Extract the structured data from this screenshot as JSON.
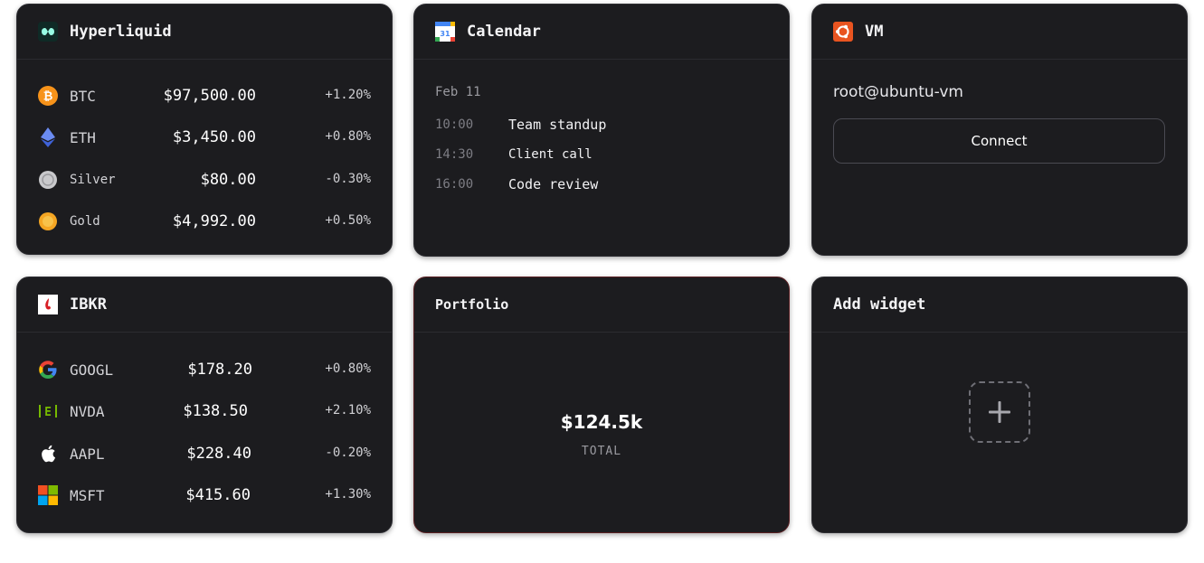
{
  "hyperliquid": {
    "title": "Hyperliquid",
    "icon": "hyperliquid-logo",
    "rows": [
      {
        "icon": "bitcoin-icon",
        "symbol": "BTC",
        "price": "$97,500.00",
        "change": "+1.20%"
      },
      {
        "icon": "ethereum-icon",
        "symbol": "ETH",
        "price": "$3,450.00",
        "change": "+0.80%"
      },
      {
        "icon": "silver-coin-icon",
        "symbol": "Silver",
        "price": "$80.00",
        "change": "-0.30%"
      },
      {
        "icon": "gold-coin-icon",
        "symbol": "Gold",
        "price": "$4,992.00",
        "change": "+0.50%"
      }
    ]
  },
  "calendar": {
    "title": "Calendar",
    "icon": "google-calendar-icon",
    "icon_day": "31",
    "date": "Feb 11",
    "events": [
      {
        "time": "10:00",
        "name": "Team standup"
      },
      {
        "time": "14:30",
        "name": "Client call"
      },
      {
        "time": "16:00",
        "name": "Code review"
      }
    ]
  },
  "vm": {
    "title": "VM",
    "icon": "ubuntu-icon",
    "host": "root@ubuntu-vm",
    "connect_label": "Connect"
  },
  "ibkr": {
    "title": "IBKR",
    "icon": "ibkr-logo",
    "rows": [
      {
        "icon": "google-icon",
        "symbol": "GOOGL",
        "price": "$178.20",
        "change": "+0.80%"
      },
      {
        "icon": "nvidia-icon",
        "symbol": "NVDA",
        "price": "$138.50",
        "change": "+2.10%"
      },
      {
        "icon": "apple-icon",
        "symbol": "AAPL",
        "price": "$228.40",
        "change": "-0.20%"
      },
      {
        "icon": "microsoft-icon",
        "symbol": "MSFT",
        "price": "$415.60",
        "change": "+1.30%"
      }
    ]
  },
  "portfolio": {
    "title": "Portfolio",
    "value": "$124.5k",
    "label": "TOTAL"
  },
  "add_widget": {
    "title": "Add widget",
    "icon": "plus-icon"
  },
  "colors": {
    "card_bg": "#1c1c1f",
    "card_border": "#2e2e33",
    "alert_border": "#5a1f22",
    "text_primary": "#f2f2f4",
    "text_muted": "#9a9aa0"
  }
}
